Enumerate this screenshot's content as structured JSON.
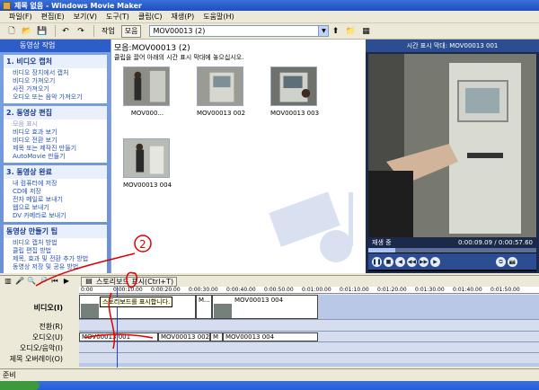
{
  "window": {
    "title": "제목 없음 - Windows Movie Maker"
  },
  "menu": [
    "파일(F)",
    "편집(E)",
    "보기(V)",
    "도구(T)",
    "클립(C)",
    "재생(P)",
    "도움말(H)"
  ],
  "toolbar": {
    "tasks_label": "작업",
    "collections_label": "모음",
    "collection_value": "MOV00013 (2)"
  },
  "taskpane": {
    "header": "동영상 작업",
    "groups": [
      {
        "title": "1. 비디오 캡처",
        "items": [
          "비디오 장치에서 캡처",
          "비디오 가져오기",
          "사진 가져오기",
          "오디오 또는 음악 가져오기"
        ]
      },
      {
        "title": "2. 동영상 편집",
        "items": [
          "모음 표시",
          "비디오 효과 보기",
          "비디오 전환 보기",
          "제목 또는 제작진 만들기",
          "AutoMovie 만들기"
        ]
      },
      {
        "title": "3. 동영상 완료",
        "items": [
          "내 컴퓨터에 저장",
          "CD에 저장",
          "전자 메일로 보내기",
          "웹으로 보내기",
          "DV 카메라로 보내기"
        ]
      },
      {
        "title": "동영상 만들기 팁",
        "items": [
          "비디오 캡처 방법",
          "클립 편집 방법",
          "제목, 효과 및 전환 추가 방법",
          "동영상 저장 및 공유 방법"
        ]
      }
    ]
  },
  "collection": {
    "title": "모음:MOV00013 (2)",
    "hint": "클립을 끌어 아래의 시간 표시 막대에 놓으십시오.",
    "clips": [
      "MOV000...",
      "MOV00013 002",
      "MOV00013 003",
      "MOV00013 004"
    ]
  },
  "monitor": {
    "title": "시간 표시 막대: MOV00013 001",
    "status": "재생 중",
    "time": "0:00:09.09 / 0:00:57.60",
    "progress": 0.16
  },
  "timeline": {
    "storyboard_label": "스토리보드 표시(Ctrl+T)",
    "tooltip": "스토리보드를 표시합니다.",
    "ruler_ticks": [
      "0:00",
      "0:00:10.00",
      "0:00:20.00",
      "0:00:30.00",
      "0:00:40.00",
      "0:00:50.00",
      "0:01:00.00",
      "0:01:10.00",
      "0:01:20.00",
      "0:01:30.00",
      "0:01:40.00",
      "0:01:50.00"
    ],
    "track_labels": {
      "video": "비디오(I)",
      "transition": "전환(R)",
      "audio": "오디오(U)",
      "music": "오디오/음악(I)",
      "narration": "제목 오버레이(O)"
    },
    "video_clips": [
      "M...",
      "MOV00013 004"
    ],
    "audio_clips": [
      "MOV00013 001",
      "MOV00013 002",
      "M",
      "MOV00013 004"
    ]
  },
  "statusbar": {
    "text": "준비"
  },
  "annotation": {
    "label": "2"
  }
}
